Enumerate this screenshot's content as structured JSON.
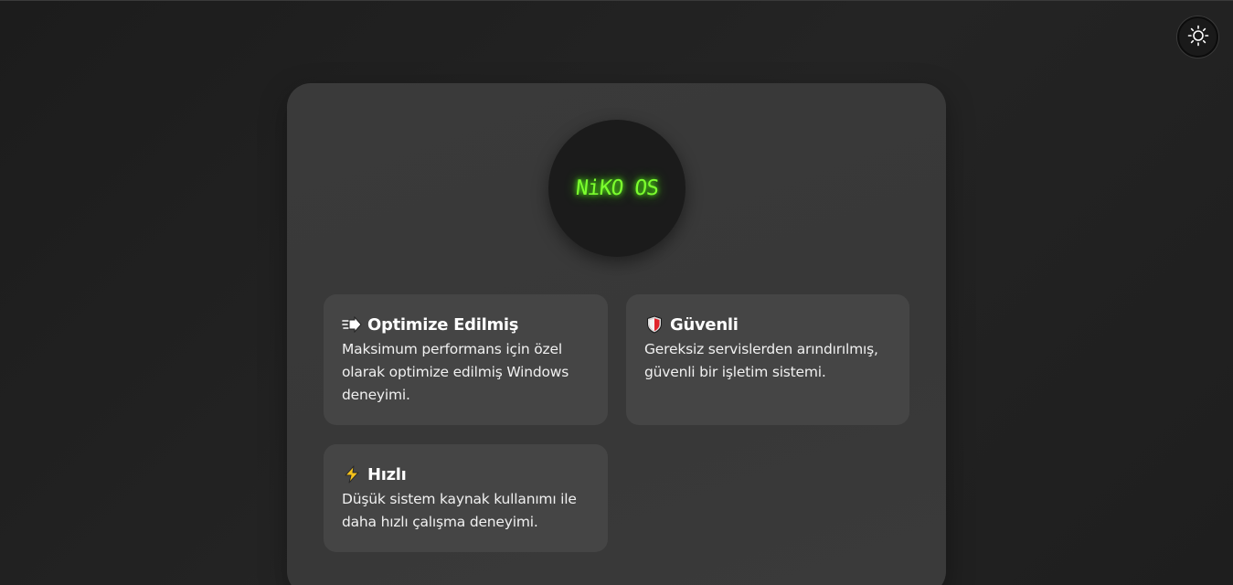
{
  "theme_toggle": {
    "icon": "sun-icon"
  },
  "logo": {
    "text": "NiKO OS",
    "color": "#7cff2e"
  },
  "features": [
    {
      "icon": "fast-arrow-icon",
      "title": "Optimize Edilmiş",
      "description": "Maksimum performans için özel olarak optimize edilmiş Windows deneyimi."
    },
    {
      "icon": "shield-icon",
      "title": "Güvenli",
      "description": "Gereksiz servislerden arındırılmış, güvenli bir işletim sistemi."
    },
    {
      "icon": "lightning-icon",
      "title": "Hızlı",
      "description": "Düşük sistem kaynak kullanımı ile daha hızlı çalışma deneyimi."
    }
  ]
}
